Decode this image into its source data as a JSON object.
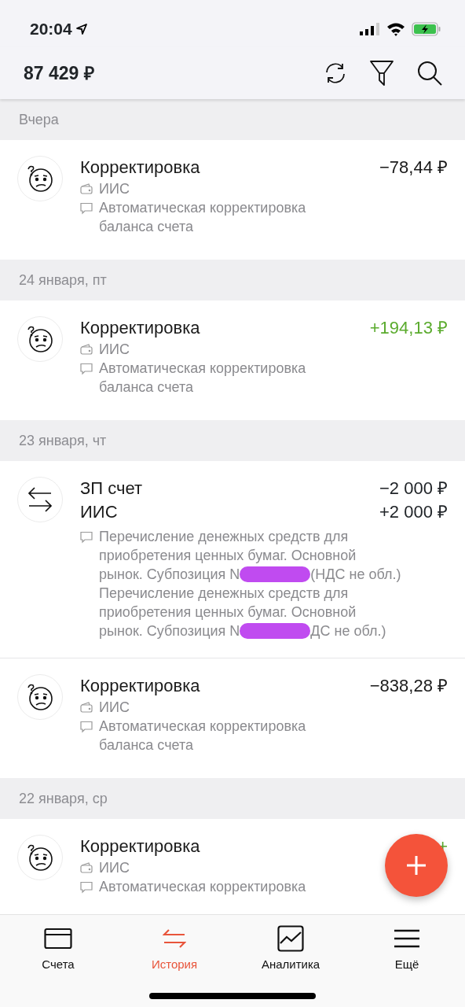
{
  "status_bar": {
    "time": "20:04"
  },
  "header": {
    "balance": "87 429 ₽"
  },
  "groups": [
    {
      "date": "Вчера",
      "items": [
        {
          "kind": "correction",
          "title": "Корректировка",
          "amount": "−78,44 ₽",
          "color": "#1a1a1a",
          "account": "ИИС",
          "note": "Автоматическая корректировка баланса счета"
        }
      ]
    },
    {
      "date": "24 января, пт",
      "items": [
        {
          "kind": "correction",
          "title": "Корректировка",
          "amount": "+194,13 ₽",
          "color": "#5bab2e",
          "account": "ИИС",
          "note": "Автоматическая корректировка баланса счета"
        }
      ]
    },
    {
      "date": "23 января, чт",
      "items": [
        {
          "kind": "transfer",
          "legs": [
            {
              "title": "ЗП счет",
              "amount": "−2 000 ₽"
            },
            {
              "title": "ИИС",
              "amount": "+2 000 ₽"
            }
          ],
          "note_lines": [
            {
              "text": "Перечисление денежных средств для"
            },
            {
              "text": "приобретения ценных бумаг. Основной"
            },
            {
              "text": "рынок. Субпозиция N",
              "after_redaction": "(НДС не обл.)"
            },
            {
              "text": "Перечисление денежных средств для"
            },
            {
              "text": "приобретения ценных бумаг. Основной"
            },
            {
              "text": "рынок. Субпозиция N",
              "after_redaction": "ДС не обл.)"
            }
          ]
        },
        {
          "kind": "correction",
          "title": "Корректировка",
          "amount": "−838,28 ₽",
          "color": "#1a1a1a",
          "account": "ИИС",
          "note": "Автоматическая корректировка баланса счета"
        }
      ]
    },
    {
      "date": "22 января, ср",
      "items": [
        {
          "kind": "correction",
          "title": "Корректировка",
          "amount": "+",
          "color": "#5bab2e",
          "account": "ИИС",
          "note": "Автоматическая корректировка"
        }
      ]
    }
  ],
  "tabs": [
    {
      "label": "Счета",
      "selected": false
    },
    {
      "label": "История",
      "selected": true
    },
    {
      "label": "Аналитика",
      "selected": false
    },
    {
      "label": "Ещё",
      "selected": false
    }
  ]
}
